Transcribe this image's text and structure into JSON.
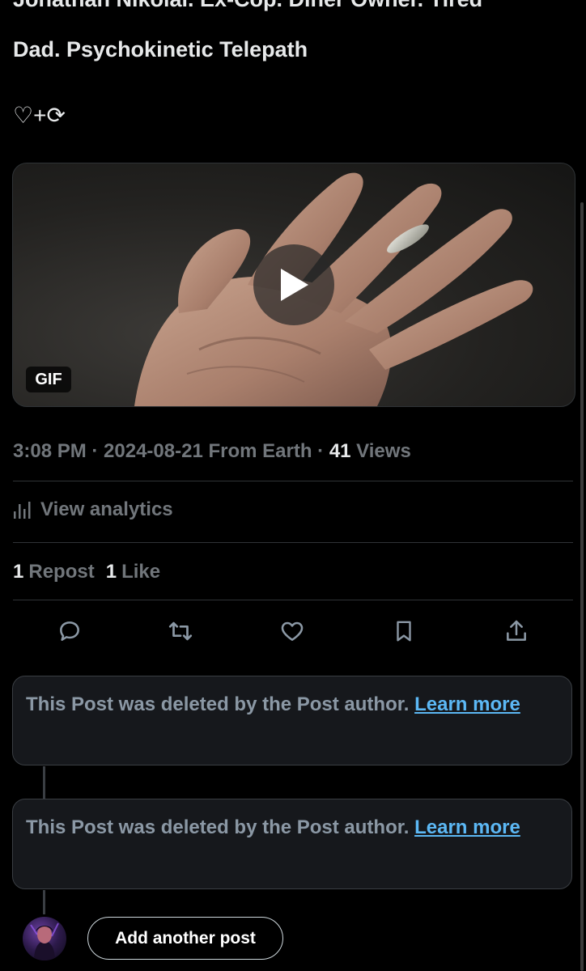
{
  "post": {
    "text_line1": "Jonathan Nikolai. Ex-Cop. Diner Owner. Tired",
    "text_line2": "Dad. Psychokinetic Telepath",
    "emoji_line": "♡+⟳"
  },
  "media": {
    "type_badge": "GIF",
    "play_icon": "play-icon"
  },
  "meta": {
    "time": "3:08 PM",
    "separator": " · ",
    "date": "2024-08-21",
    "source": " From Earth",
    "separator2": " · ",
    "views_count": "41",
    "views_label": " Views"
  },
  "analytics": {
    "label": "View analytics",
    "icon": "analytics-bars-icon"
  },
  "engagement": {
    "reposts_count": "1",
    "reposts_label": "Repost",
    "likes_count": "1",
    "likes_label": "Like"
  },
  "actions": [
    {
      "icon": "reply-icon"
    },
    {
      "icon": "repost-icon"
    },
    {
      "icon": "like-icon"
    },
    {
      "icon": "bookmark-icon"
    },
    {
      "icon": "share-icon"
    }
  ],
  "thread": {
    "deleted_1_text": "This Post was deleted by the Post author. ",
    "deleted_1_link": "Learn more",
    "deleted_2_text": "This Post was deleted by the Post author. ",
    "deleted_2_link": "Learn more"
  },
  "composer": {
    "add_post_label": "Add another post"
  },
  "colors": {
    "background": "#000000",
    "primary_text": "#e7e9ea",
    "secondary_text": "#71767b",
    "link": "#5cb8f5",
    "border": "#2f3336"
  }
}
